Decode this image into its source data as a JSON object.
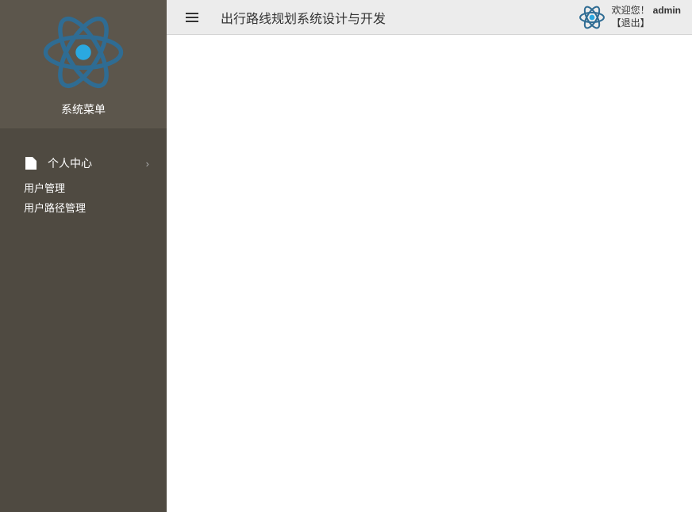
{
  "sidebar": {
    "title": "系统菜单",
    "menu": {
      "label": "个人中心",
      "submenu": [
        {
          "label": "用户管理"
        },
        {
          "label": "用户路径管理"
        }
      ]
    }
  },
  "header": {
    "title": "出行路线规划系统设计与开发",
    "welcome": "欢迎您！",
    "username": "admin",
    "logout": "【退出】"
  }
}
